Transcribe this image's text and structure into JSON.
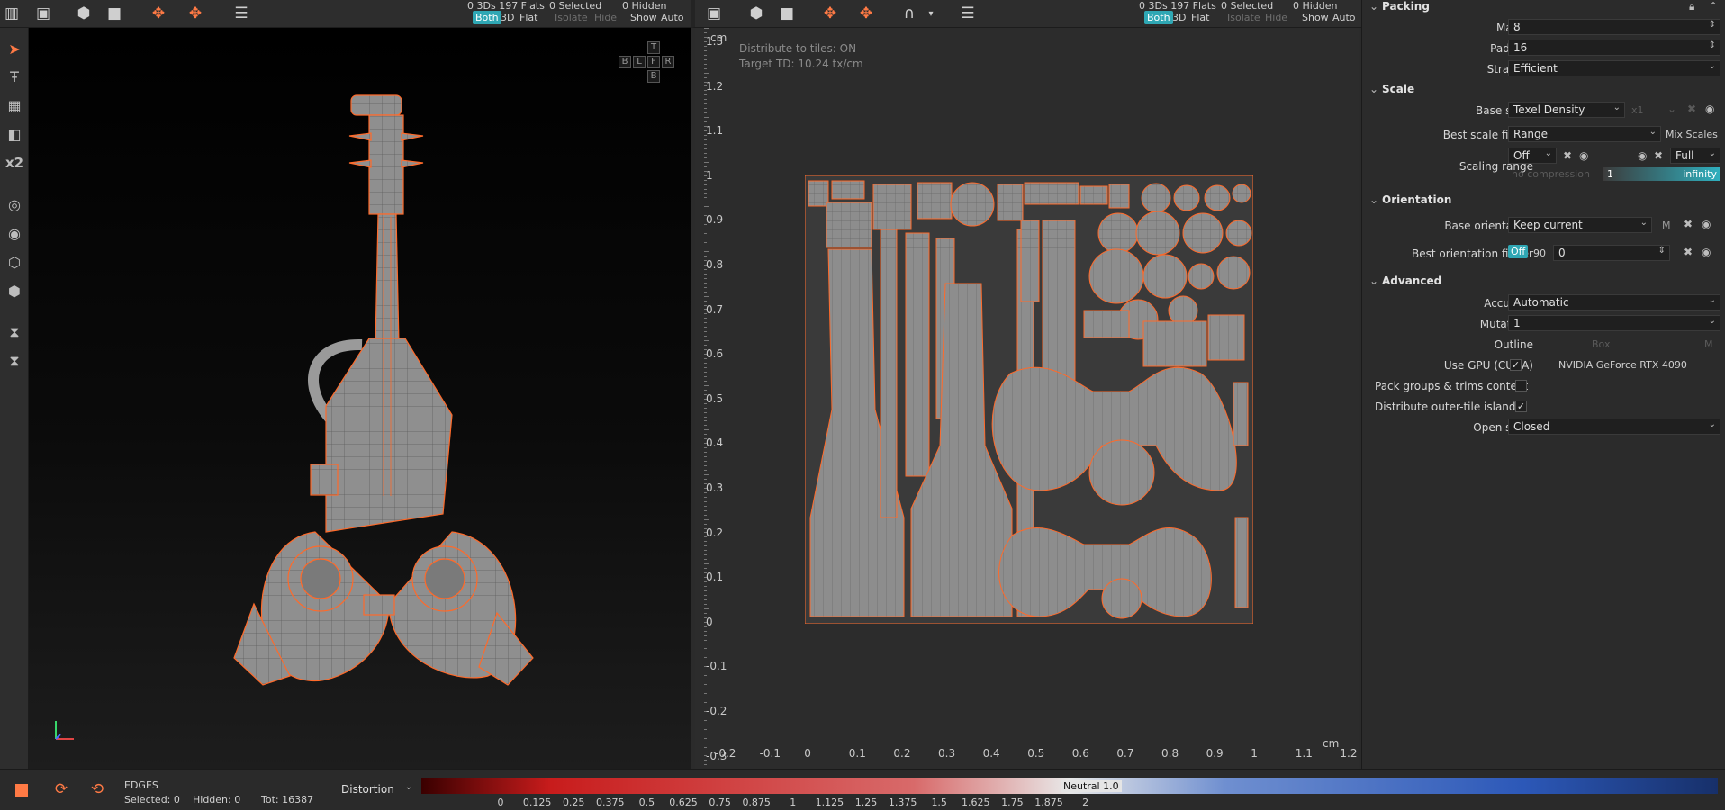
{
  "view3d_toolbar": {
    "stats": "0 3Ds 197 Flats",
    "selected": "0 Selected",
    "hidden": "0 Hidden",
    "modes": [
      "Both",
      "3D",
      "Flat"
    ],
    "isolate": "Isolate",
    "hide": "Hide",
    "show": "Show",
    "auto": "Auto"
  },
  "uv_toolbar": {
    "stats": "0 3Ds 197 Flats",
    "selected": "0 Selected",
    "hidden": "0 Hidden",
    "modes": [
      "Both",
      "3D",
      "Flat"
    ],
    "isolate": "Isolate",
    "hide": "Hide",
    "show": "Show",
    "auto": "Auto"
  },
  "left_toolbar": {
    "x2_label": "x2"
  },
  "viewcube": {
    "t": "T",
    "b": "B",
    "l": "L",
    "f": "F",
    "r": "R",
    "bottom": "B"
  },
  "uv_view": {
    "distribute_info": "Distribute to tiles: ON",
    "target_td": "Target TD: 10.24 tx/cm",
    "unit": "cm",
    "v_ticks": [
      "1.3",
      "1.2",
      "1.1",
      "1",
      "0.9",
      "0.8",
      "0.7",
      "0.6",
      "0.5",
      "0.4",
      "0.3",
      "0.2",
      "0.1",
      "0",
      "-0.1",
      "-0.2",
      "-0.3"
    ],
    "h_ticks": [
      "-0.2",
      "-0.1",
      "0",
      "0.1",
      "0.2",
      "0.3",
      "0.4",
      "0.5",
      "0.6",
      "0.7",
      "0.8",
      "0.9",
      "1",
      "1.1",
      "1.2"
    ]
  },
  "panel": {
    "packing": {
      "title": "Packing",
      "margin_label": "Margin",
      "margin_value": "8",
      "padding_label": "Padding",
      "padding_value": "16",
      "strategy_label": "Strategy",
      "strategy_value": "Efficient"
    },
    "scale": {
      "title": "Scale",
      "base_scale_label": "Base scale",
      "base_scale_value": "Texel Density",
      "base_scale_mult": "x1",
      "finder_label": "Best scale finder",
      "finder_value": "Range",
      "mix_scales": "Mix Scales",
      "range_label": "Scaling range",
      "range_off": "Off",
      "range_full": "Full",
      "no_compression": "no compression",
      "range_min": "1",
      "range_max": "infinity"
    },
    "orientation": {
      "title": "Orientation",
      "base_label": "Base orientation",
      "base_value": "Keep current",
      "m_label": "M",
      "finder_label": "Best orientation finder",
      "off": "Off",
      "ninety": "90",
      "angle": "0"
    },
    "advanced": {
      "title": "Advanced",
      "accuracy_label": "Accuracy",
      "accuracy_value": "Automatic",
      "mutations_label": "Mutations",
      "mutations_value": "1",
      "outline_label": "Outline",
      "outline_box": "Box",
      "outline_m": "M",
      "gpu_label": "Use GPU (CUDA)",
      "gpu_name": "NVIDIA GeForce RTX 4090",
      "pack_groups_label": "Pack groups & trims content",
      "distribute_label": "Distribute outer-tile islands",
      "open_sides_label": "Open sides",
      "open_sides_value": "Closed"
    }
  },
  "bottom": {
    "mode": "EDGES",
    "selected": "Selected: 0",
    "hidden": "Hidden: 0",
    "total": "Tot: 16387",
    "metric": "Distortion",
    "neutral": "Neutral 1.0",
    "scale_labels": [
      "0",
      "0.125",
      "0.25",
      "0.375",
      "0.5",
      "0.625",
      "0.75",
      "0.875",
      "1",
      "1.125",
      "1.25",
      "1.375",
      "1.5",
      "1.625",
      "1.75",
      "1.875",
      "2"
    ]
  },
  "colors": {
    "accent": "#ff7a45",
    "teal": "#2fa7b4",
    "island_fill": "#8c8c8c",
    "island_edge": "#ff6a2a"
  }
}
